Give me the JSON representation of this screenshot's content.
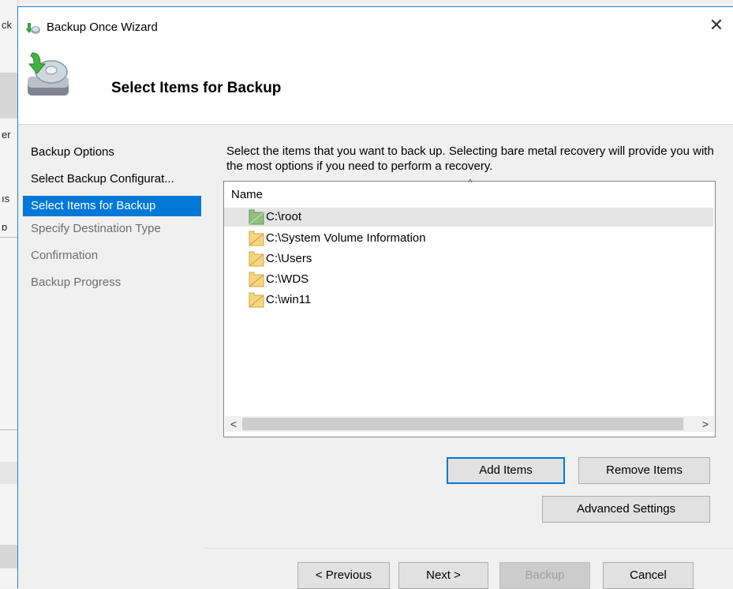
{
  "background_window": {
    "fragments": [
      "ck",
      "er",
      "ıs",
      "ɒ"
    ]
  },
  "window": {
    "title": "Backup Once Wizard",
    "close_glyph": "✕"
  },
  "header": {
    "title": "Select Items for Backup"
  },
  "steps": [
    {
      "label": "Backup Options",
      "state": "done"
    },
    {
      "label": "Select Backup Configurat...",
      "state": "done"
    },
    {
      "label": "Select Items for Backup",
      "state": "current"
    },
    {
      "label": "Specify Destination Type",
      "state": "future"
    },
    {
      "label": "Confirmation",
      "state": "future"
    },
    {
      "label": "Backup Progress",
      "state": "future"
    }
  ],
  "instructions": "Select the items that you want to back up. Selecting bare metal recovery will provide you with the most options if you need to perform a recovery.",
  "list": {
    "column_header": "Name",
    "sort_indicator": "^",
    "items": [
      {
        "label": "C:\\root",
        "selected": true,
        "icon": "folder-icon-green"
      },
      {
        "label": "C:\\System Volume Information",
        "selected": false,
        "icon": "folder-icon"
      },
      {
        "label": "C:\\Users",
        "selected": false,
        "icon": "folder-icon"
      },
      {
        "label": "C:\\WDS",
        "selected": false,
        "icon": "folder-icon"
      },
      {
        "label": "C:\\win11",
        "selected": false,
        "icon": "folder-icon"
      }
    ],
    "scroll_left": "<",
    "scroll_right": ">"
  },
  "buttons": {
    "add_items": "Add Items",
    "remove_items": "Remove Items",
    "advanced_settings": "Advanced Settings",
    "previous": "< Previous",
    "next": "Next >",
    "backup": "Backup",
    "cancel": "Cancel"
  },
  "colors": {
    "accent": "#0078d7",
    "folder": "#f5d77e",
    "folder_green": "#8fbf7f"
  }
}
